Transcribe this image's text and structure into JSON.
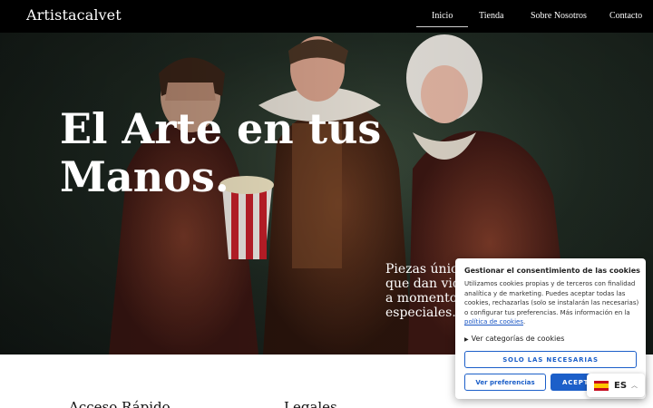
{
  "header": {
    "logo": "Artistacalvet",
    "nav": [
      {
        "label": "Inicio",
        "active": true
      },
      {
        "label": "Tienda",
        "active": false
      },
      {
        "label": "Sobre Nosotros",
        "active": false
      },
      {
        "label": "Contacto",
        "active": false
      }
    ]
  },
  "hero": {
    "title": "El Arte en tus Manos.",
    "subtitle": "Piezas únicas que dan vida a momentos especiales."
  },
  "footer": {
    "quick_access": "Acceso Rápido",
    "legal": "Legales"
  },
  "cookie_banner": {
    "title": "Gestionar el consentimiento de las cookies",
    "body": "Utilizamos cookies propias y de terceros con finalidad analítica y de marketing. Puedes aceptar todas las cookies, rechazarlas (solo se instalarán las necesarias) o configurar tus preferencias. Más información en la ",
    "policy_link": "política de cookies",
    "body_end": ".",
    "categories_toggle": "Ver categorías de cookies",
    "btn_necessary": "SOLO LAS NECESARIAS",
    "btn_preferences": "Ver preferencias",
    "btn_accept": "ACEPTAR"
  },
  "language": {
    "code": "ES",
    "flag_icon": "spain-flag-icon"
  },
  "colors": {
    "header_bg": "#000000",
    "accent": "#1c5fc9"
  }
}
